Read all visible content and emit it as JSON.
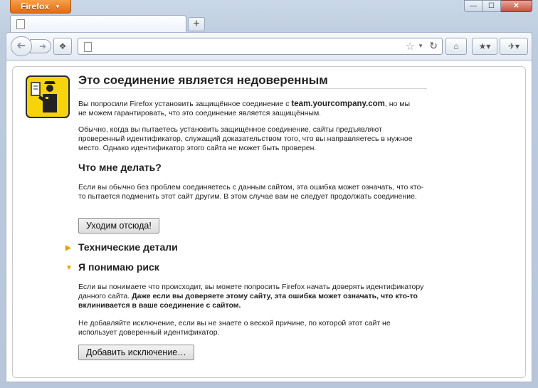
{
  "window": {
    "app_button": "Firefox",
    "controls": {
      "minimize": "—",
      "maximize": "☐",
      "close": "✕"
    }
  },
  "tab": {
    "title": ""
  },
  "toolbar": {
    "url": "",
    "back_icon": "back-arrow-icon",
    "forward_icon": "forward-arrow-icon"
  },
  "page": {
    "title": "Это соединение является недоверенным",
    "intro_prefix": "Вы попросили Firefox установить защищённое соединение с ",
    "domain": "team.yourcompany.com",
    "intro_suffix": ", но мы не можем гарантировать, что это соединение является защищённым.",
    "explain": "Обычно, когда вы пытаетесь установить защищённое соединение, сайты предъявляют проверенный идентификатор, служащий доказательством того, что вы направляетесь в нужное место. Однако идентификатор этого сайта не может быть проверен.",
    "what_to_do_heading": "Что мне делать?",
    "what_to_do_text": "Если вы обычно без проблем соединяетесь с данным сайтом, эта ошибка может означать, что кто-то пытается подменить этот сайт другим. В этом случае вам не следует продолжать соединение.",
    "get_out_button": "Уходим отсюда!",
    "technical_heading": "Технические детали",
    "risk_heading": "Я понимаю риск",
    "risk_text_plain": "Если вы понимаете что происходит, вы можете попросить Firefox начать доверять идентификатору данного сайта. ",
    "risk_text_bold": "Даже если вы доверяете этому сайту, эта ошибка может означать, что кто-то вклинивается в ваше соединение с сайтом.",
    "no_exception_text": "Не добавляйте исключение, если вы не знаете о веской причине, по которой этот сайт не использует доверенный идентификатор.",
    "add_exception_button": "Добавить исключение…"
  }
}
